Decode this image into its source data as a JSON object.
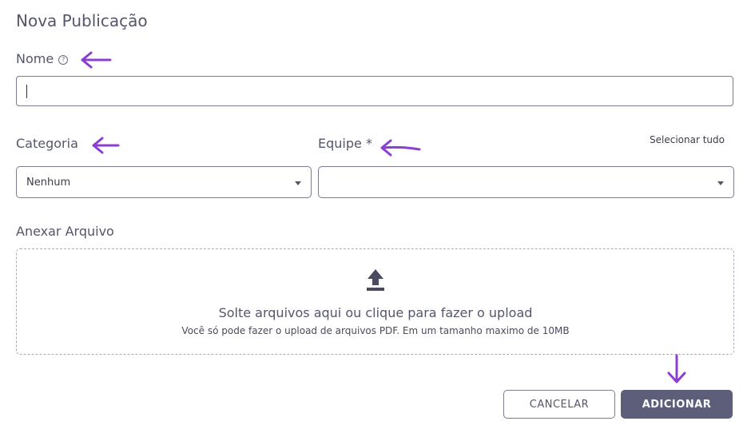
{
  "dialog": {
    "title": "Nova Publicação",
    "name_field": {
      "label": "Nome",
      "help_icon": "help-circle-icon",
      "value": ""
    },
    "category_field": {
      "label": "Categoria",
      "selected": "Nenhum"
    },
    "team_field": {
      "label": "Equipe *",
      "selected": "",
      "select_all_link": "Selecionar tudo"
    },
    "attachment": {
      "label": "Anexar Arquivo",
      "icon": "upload-icon",
      "dropzone_title": "Solte arquivos aqui ou clique para fazer o upload",
      "dropzone_hint": "Você só pode fazer o upload de arquivos PDF. Em um tamanho maximo de 10MB"
    },
    "buttons": {
      "cancel": "CANCELAR",
      "add": "ADICIONAR"
    }
  },
  "annotations": {
    "arrow_color": "#8b3fd0"
  },
  "colors": {
    "primary_button": "#5d5f7a",
    "border": "#7a7b8e"
  }
}
